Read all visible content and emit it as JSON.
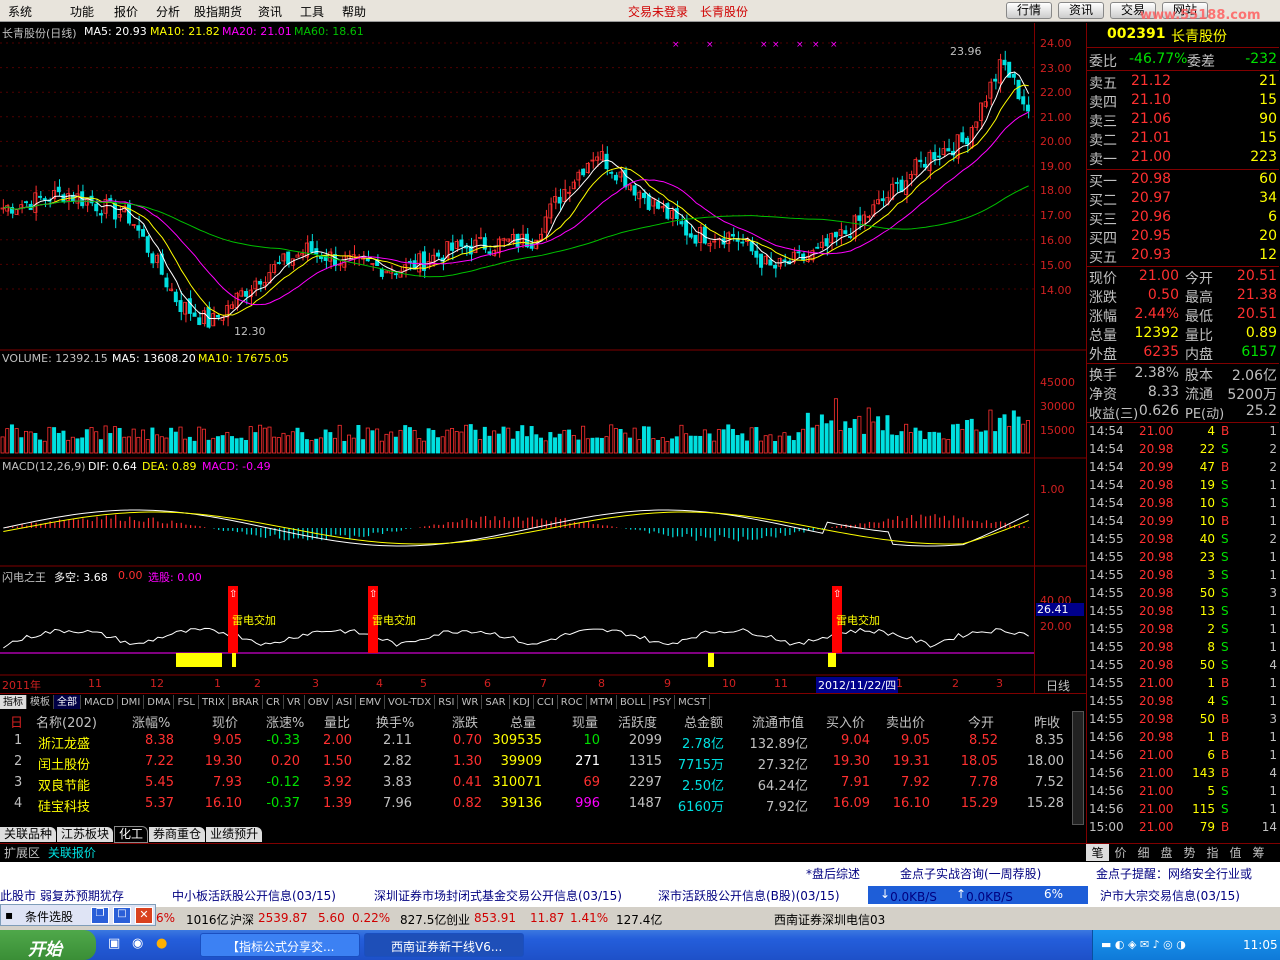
{
  "menu": {
    "items": [
      "系统",
      "功能",
      "报价",
      "分析",
      "股指期货",
      "资讯",
      "工具",
      "帮助"
    ],
    "status_trade": "交易未登录",
    "status_stock": "长青股份",
    "buttons": [
      "行情",
      "资讯",
      "交易",
      "网站"
    ],
    "watermark": "www.55188.com"
  },
  "kline": {
    "title": "长青股份(日线)",
    "ma5": "MA5: 20.93",
    "ma10": "MA10: 21.82",
    "ma20": "MA20: 21.01",
    "ma60": "MA60: 18.61",
    "high_mark": "23.96",
    "low_mark": "12.30",
    "yticks": [
      "24.00",
      "23.00",
      "22.00",
      "21.00",
      "20.00",
      "19.00",
      "18.00",
      "17.00",
      "16.00",
      "15.00",
      "14.00"
    ]
  },
  "volume": {
    "title": "VOLUME: 12392.15",
    "ma5": "MA5: 13608.20",
    "ma10": "MA10: 17675.05",
    "yticks": [
      "45000",
      "30000",
      "15000"
    ]
  },
  "macd": {
    "title": "MACD(12,26,9)",
    "dif": "DIF: 0.64",
    "dea": "DEA: 0.89",
    "macd": "MACD: -0.49",
    "ytick": "1.00"
  },
  "flash": {
    "title": "闪电之王",
    "duokong": "多空: 3.68",
    "v2": "0.00",
    "xuangu": "选股: 0.00",
    "signal": "雷电交加",
    "yticks": [
      "40.00",
      "20.00"
    ],
    "cur": "26.41"
  },
  "dateaxis": {
    "labels": [
      "2011年",
      "11",
      "12",
      "1",
      "2",
      "3",
      "4",
      "5",
      "6",
      "7",
      "8",
      "9",
      "10",
      "11",
      "2012/11/22/四",
      "1",
      "2",
      "3"
    ],
    "period": "日线"
  },
  "indtabs": [
    "指标",
    "模板",
    "全部",
    "MACD",
    "DMI",
    "DMA",
    "FSL",
    "TRIX",
    "BRAR",
    "CR",
    "VR",
    "OBV",
    "ASI",
    "EMV",
    "VOL-TDX",
    "RSI",
    "WR",
    "SAR",
    "KDJ",
    "CCI",
    "ROC",
    "MTM",
    "BOLL",
    "PSY",
    "MCST"
  ],
  "table": {
    "headers": [
      "名称(202)",
      "涨幅%",
      "现价",
      "涨速%",
      "量比",
      "换手%",
      "涨跌",
      "总量",
      "现量",
      "活跃度",
      "总金额",
      "流通市值",
      "买入价",
      "卖出价",
      "今开",
      "昨收"
    ],
    "rows": [
      [
        "1",
        "浙江龙盛",
        "8.38",
        "9.05",
        "-0.33",
        "2.00",
        "2.11",
        "0.70",
        "309535",
        "10",
        "2099",
        "2.78亿",
        "132.89亿",
        "9.04",
        "9.05",
        "8.52",
        "8.35"
      ],
      [
        "2",
        "闰土股份",
        "7.22",
        "19.30",
        "0.20",
        "1.50",
        "2.82",
        "1.30",
        "39909",
        "271",
        "1315",
        "7715万",
        "27.32亿",
        "19.30",
        "19.31",
        "18.05",
        "18.00"
      ],
      [
        "3",
        "双良节能",
        "5.45",
        "7.93",
        "-0.12",
        "3.92",
        "3.83",
        "0.41",
        "310071",
        "69",
        "2297",
        "2.50亿",
        "64.24亿",
        "7.91",
        "7.92",
        "7.78",
        "7.52"
      ],
      [
        "4",
        "硅宝科技",
        "5.37",
        "16.10",
        "-0.37",
        "1.39",
        "7.96",
        "0.82",
        "39136",
        "996",
        "1487",
        "6160万",
        "7.92亿",
        "16.09",
        "16.10",
        "15.29",
        "15.28"
      ]
    ]
  },
  "bottomtabs": [
    "关联品种",
    "江苏板块",
    "化工",
    "券商重仓",
    "业绩预升"
  ],
  "ext": {
    "label": "扩展区",
    "link": "关联报价"
  },
  "quote": {
    "code": "002391",
    "name": "长青股份",
    "weibi_l": "委比",
    "weibi": "-46.77%",
    "weicha_l": "委差",
    "weicha": "-232",
    "sells": [
      [
        "卖五",
        "21.12",
        "21"
      ],
      [
        "卖四",
        "21.10",
        "15"
      ],
      [
        "卖三",
        "21.06",
        "90"
      ],
      [
        "卖二",
        "21.01",
        "15"
      ],
      [
        "卖一",
        "21.00",
        "223"
      ]
    ],
    "buys": [
      [
        "买一",
        "20.98",
        "60"
      ],
      [
        "买二",
        "20.97",
        "34"
      ],
      [
        "买三",
        "20.96",
        "6"
      ],
      [
        "买四",
        "20.95",
        "20"
      ],
      [
        "买五",
        "20.93",
        "12"
      ]
    ],
    "stats": [
      [
        "现价",
        "21.00",
        "今开",
        "20.51"
      ],
      [
        "涨跌",
        "0.50",
        "最高",
        "21.38"
      ],
      [
        "涨幅",
        "2.44%",
        "最低",
        "20.51"
      ],
      [
        "总量",
        "12392",
        "量比",
        "0.89"
      ],
      [
        "外盘",
        "6235",
        "内盘",
        "6157"
      ]
    ],
    "stats2": [
      [
        "换手",
        "2.38%",
        "股本",
        "2.06亿"
      ],
      [
        "净资",
        "8.33",
        "流通",
        "5200万"
      ],
      [
        "收益(三)",
        "0.626",
        "PE(动)",
        "25.2"
      ]
    ]
  },
  "ticks": [
    [
      "14:54",
      "21.00",
      "4",
      "B",
      "1"
    ],
    [
      "14:54",
      "20.98",
      "22",
      "S",
      "2"
    ],
    [
      "14:54",
      "20.99",
      "47",
      "B",
      "2"
    ],
    [
      "14:54",
      "20.98",
      "19",
      "S",
      "1"
    ],
    [
      "14:54",
      "20.98",
      "10",
      "S",
      "1"
    ],
    [
      "14:54",
      "20.99",
      "10",
      "B",
      "1"
    ],
    [
      "14:55",
      "20.98",
      "40",
      "S",
      "2"
    ],
    [
      "14:55",
      "20.98",
      "23",
      "S",
      "1"
    ],
    [
      "14:55",
      "20.98",
      "3",
      "S",
      "1"
    ],
    [
      "14:55",
      "20.98",
      "50",
      "S",
      "3"
    ],
    [
      "14:55",
      "20.98",
      "13",
      "S",
      "1"
    ],
    [
      "14:55",
      "20.98",
      "2",
      "S",
      "1"
    ],
    [
      "14:55",
      "20.98",
      "8",
      "S",
      "1"
    ],
    [
      "14:55",
      "20.98",
      "50",
      "S",
      "4"
    ],
    [
      "14:55",
      "21.00",
      "1",
      "B",
      "1"
    ],
    [
      "14:55",
      "20.98",
      "4",
      "S",
      "1"
    ],
    [
      "14:55",
      "20.98",
      "50",
      "B",
      "3"
    ],
    [
      "14:56",
      "20.98",
      "1",
      "B",
      "1"
    ],
    [
      "14:56",
      "21.00",
      "6",
      "B",
      "1"
    ],
    [
      "14:56",
      "21.00",
      "143",
      "B",
      "4"
    ],
    [
      "14:56",
      "21.00",
      "5",
      "S",
      "1"
    ],
    [
      "14:56",
      "21.00",
      "115",
      "S",
      "1"
    ],
    [
      "15:00",
      "21.00",
      "79",
      "B",
      "14"
    ]
  ],
  "rtabs": [
    "笔",
    "价",
    "细",
    "盘",
    "势",
    "指",
    "值",
    "筹"
  ],
  "news1": [
    "*盘后综述",
    "金点子实战咨询(一周荐股)",
    "金点子提醒：网络安全行业或"
  ],
  "news2": [
    "此股市  弱复苏预期犹存",
    "中小板活跃股公开信息(03/15)",
    "深圳证券市场封闭式基金交易公开信息(03/15)",
    "深市活跃股公开信息(B股)(03/15)",
    "0.0KB/S",
    "0.0KB/S",
    "6%",
    "沪市大宗交易信息(03/15)"
  ],
  "status": {
    "cond": "条件选股",
    "pct": "6%",
    "amt1": "1016亿",
    "hs": "沪深",
    "hsv": "2539.87",
    "hsc": "5.60",
    "hsp": "0.22%",
    "hsa": "827.5亿",
    "cy": "创业",
    "cyv": "853.91",
    "cyc": "11.87",
    "cyp": "1.41%",
    "cya": "127.4亿",
    "broker": "西南证券深圳电信03"
  },
  "taskbar": {
    "start": "开始",
    "task1": "【指标公式分享交...",
    "task2": "西南证券新干线V6...",
    "clock": "11:05"
  },
  "colors": {
    "up": "#ff3030",
    "down": "#00e0e0",
    "ma5": "#ffffff",
    "ma10": "#ffff00",
    "ma20": "#ff00ff",
    "ma60": "#00c000"
  }
}
